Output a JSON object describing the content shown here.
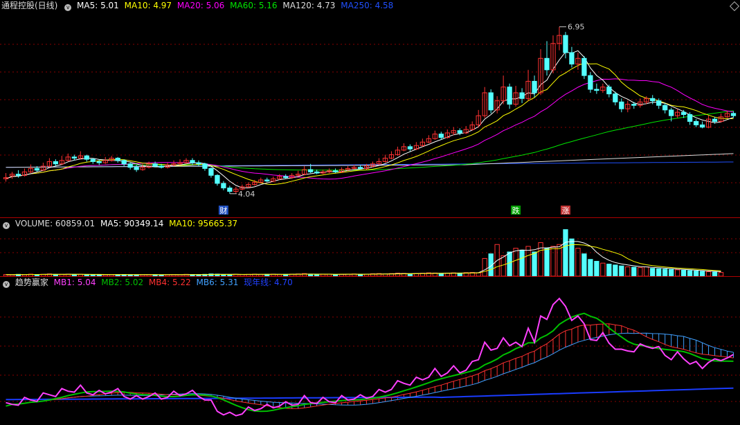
{
  "main_legend": {
    "title": "通程控股(日线)",
    "ma5": "MA5: 5.01",
    "ma10": "MA10: 4.97",
    "ma20": "MA20: 5.06",
    "ma60": "MA60: 5.16",
    "ma120": "MA120: 4.73",
    "ma250": "MA250: 4.58"
  },
  "vol_legend": {
    "volume": "VOLUME: 60859.01",
    "ma5": "MA5: 90349.14",
    "ma10": "MA10: 95665.37"
  },
  "ind_legend": {
    "title": "趋势赢家",
    "mb1": "MB1: 5.04",
    "mb2": "MB2: 5.02",
    "mb4": "MB4: 5.22",
    "mb6": "MB6: 5.31",
    "niannian": "现年线: 4.70"
  },
  "annotations": {
    "high": "6.95",
    "low": "4.04",
    "cai": "财",
    "die": "跌",
    "zhang": "涨"
  },
  "colors": {
    "up": "#ff3232",
    "down": "#54ffff",
    "ma5": "#ffffff",
    "ma10": "#ffff00",
    "ma20": "#ff00ff",
    "ma60": "#00e600",
    "ma120": "#dddddd",
    "ma250": "#2050ff",
    "grid": "#8c0000"
  },
  "chart_data": [
    {
      "type": "candlestick",
      "price_range": [
        3.7,
        7.2
      ],
      "high": 6.95,
      "low": 4.04,
      "candles": [
        [
          4.32,
          4.3,
          4.4,
          4.25,
          1
        ],
        [
          4.35,
          4.38,
          4.42,
          4.3,
          1
        ],
        [
          4.38,
          4.36,
          4.45,
          4.32,
          0
        ],
        [
          4.36,
          4.42,
          4.48,
          4.34,
          1
        ],
        [
          4.42,
          4.48,
          4.55,
          4.4,
          1
        ],
        [
          4.48,
          4.45,
          4.52,
          4.42,
          0
        ],
        [
          4.45,
          4.52,
          4.58,
          4.44,
          1
        ],
        [
          4.52,
          4.6,
          4.66,
          4.5,
          1
        ],
        [
          4.6,
          4.56,
          4.64,
          4.52,
          0
        ],
        [
          4.56,
          4.62,
          4.7,
          4.54,
          1
        ],
        [
          4.62,
          4.68,
          4.74,
          4.6,
          1
        ],
        [
          4.68,
          4.66,
          4.72,
          4.62,
          0
        ],
        [
          4.66,
          4.7,
          4.78,
          4.64,
          1
        ],
        [
          4.7,
          4.64,
          4.72,
          4.6,
          0
        ],
        [
          4.64,
          4.6,
          4.66,
          4.56,
          0
        ],
        [
          4.6,
          4.58,
          4.64,
          4.54,
          0
        ],
        [
          4.58,
          4.62,
          4.68,
          4.56,
          1
        ],
        [
          4.62,
          4.66,
          4.7,
          4.6,
          1
        ],
        [
          4.66,
          4.62,
          4.68,
          4.58,
          0
        ],
        [
          4.62,
          4.56,
          4.64,
          4.52,
          0
        ],
        [
          4.56,
          4.5,
          4.58,
          4.46,
          0
        ],
        [
          4.5,
          4.46,
          4.54,
          4.42,
          0
        ],
        [
          4.46,
          4.5,
          4.56,
          4.44,
          1
        ],
        [
          4.5,
          4.56,
          4.6,
          4.48,
          1
        ],
        [
          4.56,
          4.52,
          4.6,
          4.5,
          0
        ],
        [
          4.52,
          4.5,
          4.56,
          4.48,
          0
        ],
        [
          4.5,
          4.54,
          4.58,
          4.48,
          1
        ],
        [
          4.54,
          4.56,
          4.62,
          4.52,
          1
        ],
        [
          4.56,
          4.58,
          4.64,
          4.54,
          1
        ],
        [
          4.58,
          4.62,
          4.66,
          4.56,
          1
        ],
        [
          4.62,
          4.58,
          4.66,
          4.54,
          0
        ],
        [
          4.58,
          4.56,
          4.62,
          4.52,
          0
        ],
        [
          4.56,
          4.48,
          4.58,
          4.44,
          0
        ],
        [
          4.48,
          4.36,
          4.5,
          4.32,
          0
        ],
        [
          4.36,
          4.22,
          4.38,
          4.18,
          0
        ],
        [
          4.22,
          4.14,
          4.26,
          4.1,
          0
        ],
        [
          4.14,
          4.08,
          4.18,
          4.04,
          0
        ],
        [
          4.08,
          4.12,
          4.16,
          4.04,
          1
        ],
        [
          4.12,
          4.16,
          4.2,
          4.1,
          1
        ],
        [
          4.16,
          4.2,
          4.24,
          4.14,
          1
        ],
        [
          4.2,
          4.24,
          4.28,
          4.18,
          1
        ],
        [
          4.24,
          4.28,
          4.32,
          4.22,
          1
        ],
        [
          4.28,
          4.26,
          4.32,
          4.24,
          0
        ],
        [
          4.26,
          4.3,
          4.34,
          4.24,
          1
        ],
        [
          4.3,
          4.34,
          4.38,
          4.28,
          1
        ],
        [
          4.34,
          4.32,
          4.38,
          4.3,
          0
        ],
        [
          4.32,
          4.36,
          4.4,
          4.3,
          1
        ],
        [
          4.36,
          4.38,
          4.44,
          4.34,
          1
        ],
        [
          4.38,
          4.46,
          4.52,
          4.36,
          1
        ],
        [
          4.46,
          4.42,
          4.56,
          4.4,
          0
        ],
        [
          4.42,
          4.4,
          4.46,
          4.38,
          0
        ],
        [
          4.4,
          4.42,
          4.46,
          4.38,
          1
        ],
        [
          4.42,
          4.44,
          4.48,
          4.4,
          1
        ],
        [
          4.44,
          4.42,
          4.48,
          4.4,
          0
        ],
        [
          4.42,
          4.46,
          4.5,
          4.4,
          1
        ],
        [
          4.46,
          4.48,
          4.52,
          4.44,
          1
        ],
        [
          4.48,
          4.5,
          4.54,
          4.46,
          1
        ],
        [
          4.5,
          4.48,
          4.54,
          4.46,
          0
        ],
        [
          4.48,
          4.52,
          4.56,
          4.46,
          1
        ],
        [
          4.52,
          4.56,
          4.6,
          4.5,
          1
        ],
        [
          4.56,
          4.6,
          4.66,
          4.54,
          1
        ],
        [
          4.6,
          4.66,
          4.72,
          4.58,
          1
        ],
        [
          4.66,
          4.72,
          4.78,
          4.64,
          1
        ],
        [
          4.72,
          4.8,
          4.86,
          4.7,
          1
        ],
        [
          4.8,
          4.86,
          4.92,
          4.78,
          1
        ],
        [
          4.86,
          4.82,
          4.9,
          4.78,
          0
        ],
        [
          4.82,
          4.88,
          4.94,
          4.8,
          1
        ],
        [
          4.88,
          4.94,
          5.0,
          4.86,
          1
        ],
        [
          4.94,
          5.0,
          5.06,
          4.92,
          1
        ],
        [
          5.0,
          5.08,
          5.14,
          4.98,
          1
        ],
        [
          5.08,
          5.02,
          5.12,
          4.98,
          0
        ],
        [
          5.02,
          5.1,
          5.16,
          5.0,
          1
        ],
        [
          5.1,
          5.14,
          5.2,
          5.06,
          1
        ],
        [
          5.14,
          5.1,
          5.18,
          5.06,
          0
        ],
        [
          5.1,
          5.16,
          5.22,
          5.08,
          1
        ],
        [
          5.16,
          5.24,
          5.3,
          5.14,
          1
        ],
        [
          5.24,
          5.4,
          5.5,
          5.2,
          1
        ],
        [
          5.4,
          5.8,
          5.9,
          5.36,
          1
        ],
        [
          5.8,
          5.5,
          5.86,
          5.44,
          0
        ],
        [
          5.5,
          5.66,
          5.74,
          5.44,
          1
        ],
        [
          5.66,
          5.9,
          6.1,
          5.6,
          1
        ],
        [
          5.9,
          5.6,
          5.96,
          5.52,
          0
        ],
        [
          5.6,
          5.8,
          5.92,
          5.56,
          1
        ],
        [
          5.8,
          5.7,
          5.88,
          5.62,
          0
        ],
        [
          5.7,
          6.0,
          6.2,
          5.66,
          1
        ],
        [
          6.0,
          5.8,
          6.1,
          5.72,
          0
        ],
        [
          5.8,
          6.4,
          6.56,
          5.76,
          1
        ],
        [
          6.4,
          6.2,
          6.7,
          6.1,
          0
        ],
        [
          6.2,
          6.66,
          6.8,
          6.14,
          1
        ],
        [
          6.66,
          6.8,
          6.95,
          6.54,
          1
        ],
        [
          6.8,
          6.5,
          6.86,
          6.4,
          0
        ],
        [
          6.5,
          6.3,
          6.6,
          6.24,
          0
        ],
        [
          6.3,
          6.4,
          6.5,
          6.2,
          1
        ],
        [
          6.4,
          6.1,
          6.44,
          6.04,
          0
        ],
        [
          6.1,
          5.86,
          6.16,
          5.8,
          0
        ],
        [
          5.86,
          5.84,
          5.96,
          5.78,
          0
        ],
        [
          5.84,
          5.9,
          5.96,
          5.8,
          1
        ],
        [
          5.9,
          5.78,
          5.94,
          5.72,
          0
        ],
        [
          5.78,
          5.64,
          5.82,
          5.58,
          0
        ],
        [
          5.64,
          5.52,
          5.7,
          5.46,
          0
        ],
        [
          5.52,
          5.6,
          5.66,
          5.46,
          1
        ],
        [
          5.6,
          5.58,
          5.64,
          5.52,
          0
        ],
        [
          5.58,
          5.64,
          5.7,
          5.54,
          1
        ],
        [
          5.64,
          5.7,
          5.74,
          5.6,
          1
        ],
        [
          5.7,
          5.66,
          5.76,
          5.6,
          0
        ],
        [
          5.66,
          5.58,
          5.7,
          5.52,
          0
        ],
        [
          5.58,
          5.5,
          5.62,
          5.44,
          0
        ],
        [
          5.5,
          5.4,
          5.54,
          5.3,
          0
        ],
        [
          5.4,
          5.46,
          5.52,
          5.36,
          1
        ],
        [
          5.46,
          5.42,
          5.5,
          5.36,
          0
        ],
        [
          5.42,
          5.3,
          5.46,
          5.24,
          0
        ],
        [
          5.3,
          5.24,
          5.34,
          5.2,
          0
        ],
        [
          5.24,
          5.2,
          5.3,
          5.18,
          0
        ],
        [
          5.2,
          5.34,
          5.4,
          5.18,
          1
        ],
        [
          5.34,
          5.3,
          5.38,
          5.26,
          0
        ],
        [
          5.3,
          5.38,
          5.44,
          5.28,
          1
        ],
        [
          5.38,
          5.44,
          5.48,
          5.36,
          1
        ],
        [
          5.44,
          5.4,
          5.48,
          5.36,
          0
        ]
      ]
    },
    {
      "type": "bar",
      "series": "volume",
      "values": [
        9,
        8,
        10,
        9,
        11,
        8,
        10,
        12,
        9,
        10,
        11,
        9,
        10,
        8,
        9,
        7,
        8,
        9,
        8,
        9,
        8,
        7,
        8,
        9,
        8,
        7,
        8,
        9,
        8,
        10,
        9,
        8,
        10,
        12,
        11,
        9,
        8,
        10,
        9,
        10,
        11,
        9,
        10,
        11,
        9,
        10,
        11,
        12,
        14,
        10,
        9,
        10,
        11,
        9,
        10,
        11,
        12,
        10,
        11,
        13,
        14,
        12,
        14,
        16,
        15,
        13,
        14,
        16,
        18,
        17,
        15,
        16,
        18,
        17,
        19,
        20,
        18,
        95,
        120,
        170,
        110,
        130,
        150,
        140,
        160,
        130,
        180,
        150,
        160,
        170,
        250,
        200,
        150,
        120,
        90,
        80,
        70,
        65,
        60,
        55,
        50,
        48,
        46,
        50,
        42,
        40,
        38,
        36,
        34,
        32,
        30,
        28,
        26,
        24,
        22,
        20
      ]
    }
  ]
}
